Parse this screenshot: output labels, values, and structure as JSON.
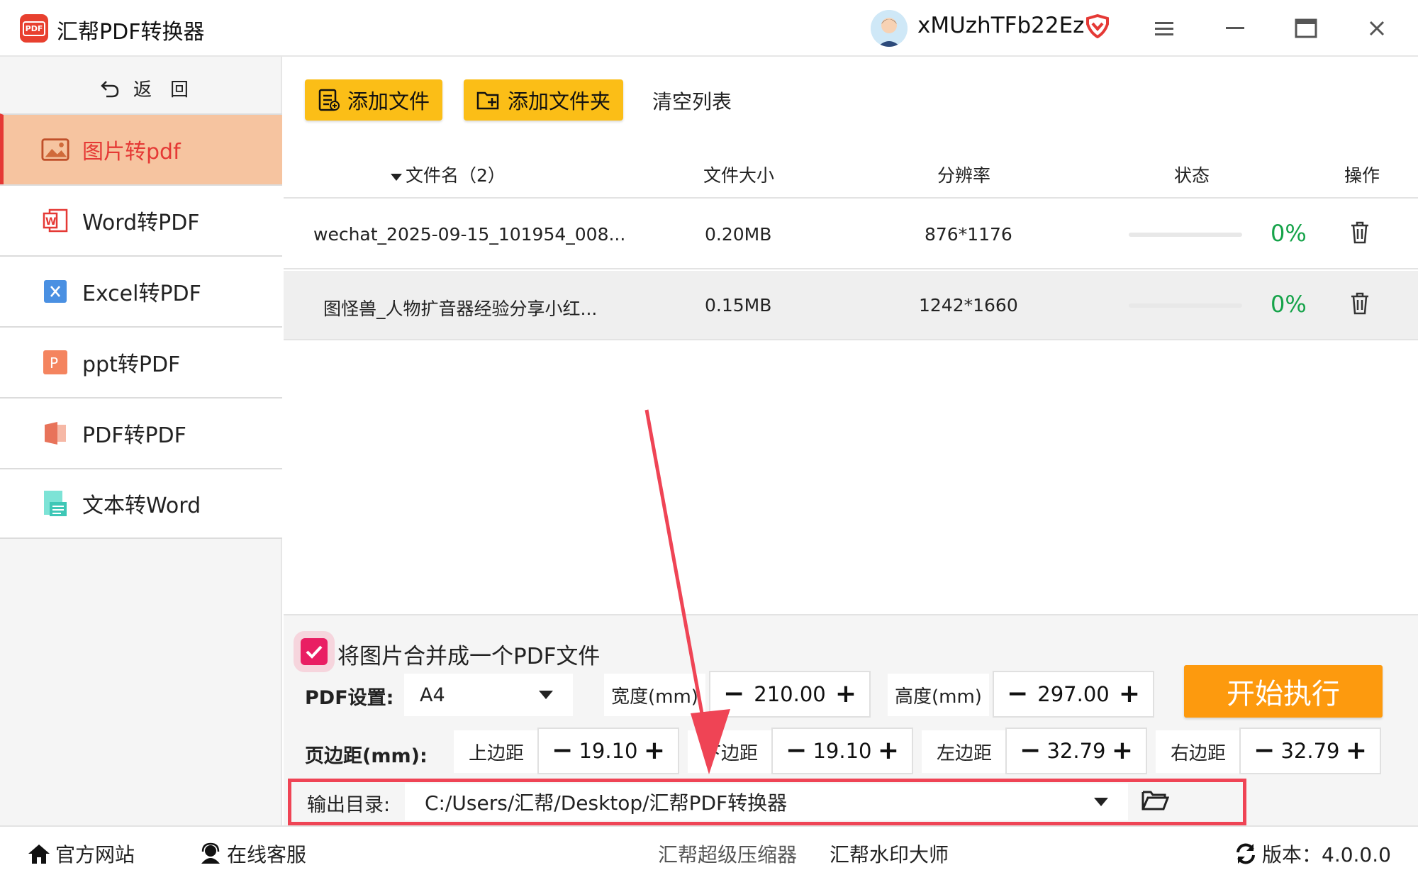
{
  "app": {
    "title": "汇帮PDF转换器",
    "logo_text": "PDF"
  },
  "user": {
    "name": "xMUzhTFb22Ez"
  },
  "sidebar": {
    "back_label": "返　回",
    "items": [
      {
        "label": "图片转pdf",
        "icon": "image-icon",
        "active": true
      },
      {
        "label": "Word转PDF",
        "icon": "word-icon",
        "active": false
      },
      {
        "label": "Excel转PDF",
        "icon": "excel-icon",
        "active": false
      },
      {
        "label": "ppt转PDF",
        "icon": "ppt-icon",
        "active": false
      },
      {
        "label": "PDF转PDF",
        "icon": "pdf-icon",
        "active": false
      },
      {
        "label": "文本转Word",
        "icon": "text-icon",
        "active": false
      }
    ]
  },
  "toolbar": {
    "add_file": "添加文件",
    "add_folder": "添加文件夹",
    "clear": "清空列表"
  },
  "table": {
    "headers": {
      "filename": "文件名（2）",
      "size": "文件大小",
      "resolution": "分辨率",
      "status": "状态",
      "action": "操作"
    },
    "rows": [
      {
        "name": "wechat_2025-09-15_101954_008...",
        "size": "0.20MB",
        "resolution": "876*1176",
        "progress": 0,
        "percent": "0%"
      },
      {
        "name": "图怪兽_人物扩音器经验分享小红...",
        "size": "0.15MB",
        "resolution": "1242*1660",
        "progress": 0,
        "percent": "0%"
      }
    ]
  },
  "settings": {
    "merge_label": "将图片合并成一个PDF文件",
    "merge_checked": true,
    "pdf_label": "PDF设置:",
    "page_size": "A4",
    "width_label": "宽度(mm)",
    "width_value": "210.00",
    "height_label": "高度(mm)",
    "height_value": "297.00",
    "margin_label": "页边距(mm):",
    "top_label": "上边距",
    "top_value": "19.10",
    "bottom_label": "下边距",
    "bottom_value": "19.10",
    "left_label": "左边距",
    "left_value": "32.79",
    "right_label": "右边距",
    "right_value": "32.79",
    "start_label": "开始执行",
    "output_label": "输出目录:",
    "output_path": "C:/Users/汇帮/Desktop/汇帮PDF转换器"
  },
  "footer": {
    "website": "官方网站",
    "support": "在线客服",
    "compressor": "汇帮超级压缩器",
    "watermark": "汇帮水印大师",
    "version": "版本：4.0.0.0"
  },
  "colors": {
    "accent": "#e53935",
    "yellow": "#fbbe17",
    "orange": "#fd9a0e",
    "highlight": "#ef4455",
    "success": "#16a34a"
  }
}
